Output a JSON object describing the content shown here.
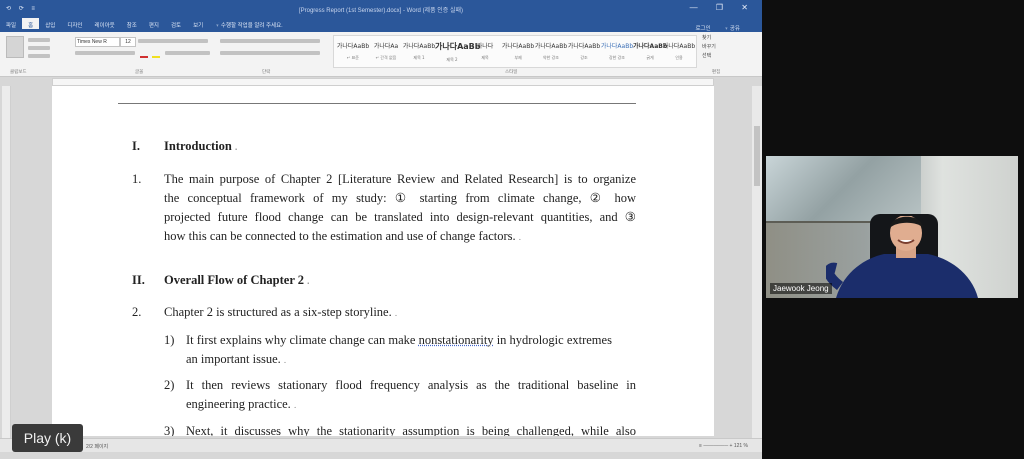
{
  "word": {
    "title": "[Progress Report (1st Semester).docx] - Word (제품 인증 실패)",
    "quick_access_icons": "⟲ ⟳ ≡",
    "window_controls": "— ❐ ✕",
    "tabs": [
      "파일",
      "홈",
      "삽입",
      "디자인",
      "레이아웃",
      "참조",
      "편지",
      "검토",
      "보기",
      "♀ 수행할 작업을 알려 주세요."
    ],
    "active_tab_index": 1,
    "tab_right": [
      "로그인",
      "♀ 공유"
    ],
    "ribbon": {
      "font_name": "Times New R",
      "font_size": "12",
      "groups": [
        "클립보드",
        "글꼴",
        "단락",
        "스타일",
        "편집"
      ],
      "styles": [
        {
          "sample": "가나다AaBb",
          "name": "↵ 표준"
        },
        {
          "sample": "가나다Aa",
          "name": "↵ 간격 없음"
        },
        {
          "sample": "가나다AaBb",
          "name": "제목 1"
        },
        {
          "sample": "가나다AaBb",
          "name": "제목 2"
        },
        {
          "sample": "가나다",
          "name": "제목"
        },
        {
          "sample": "가나다AaBb",
          "name": "부제"
        },
        {
          "sample": "가나다AaBb",
          "name": "약한 강조"
        },
        {
          "sample": "가나다AaBb",
          "name": "강조"
        },
        {
          "sample": "가나다AaBb",
          "name": "강한 강조"
        },
        {
          "sample": "가나다AaBb",
          "name": "굵게"
        },
        {
          "sample": "가나다AaBb",
          "name": "인용"
        }
      ],
      "edit": [
        "찾기",
        "바꾸기",
        "선택"
      ]
    },
    "document": {
      "section1_num": "I.",
      "section1_title": "Introduction",
      "item1_num": "1.",
      "item1_lines": [
        "The main purpose of Chapter 2 [Literature Review and Related Research] is to organize",
        "the conceptual framework of my study: ① starting from climate change, ② how",
        "projected future flood change can be translated into design-relevant quantities, and ③",
        "how this can be connected to the estimation and use of change factors."
      ],
      "section2_num": "II.",
      "section2_title": "Overall Flow of Chapter 2",
      "item2_num": "2.",
      "item2_text": "Chapter 2 is structured as a six-step storyline.",
      "sub1_num": "1)",
      "sub1_pre": "It first explains why climate change can make ",
      "sub1_link": "nonstationarity",
      "sub1_post": " in hydrologic extremes",
      "sub1_line2": "an important issue.",
      "sub2_num": "2)",
      "sub2_line1": "It then reviews stationary flood frequency analysis as the traditional baseline in",
      "sub2_line2": "engineering practice.",
      "sub3_num": "3)",
      "sub3_line1": "Next, it discusses why the stationarity assumption is being challenged, while also"
    },
    "status_left": "2/2 페이지",
    "status_right": "≡ ─────── + 121 %"
  },
  "participant": {
    "name": "Jaewook Jeong"
  },
  "player": {
    "play_label": "Play (k)"
  }
}
